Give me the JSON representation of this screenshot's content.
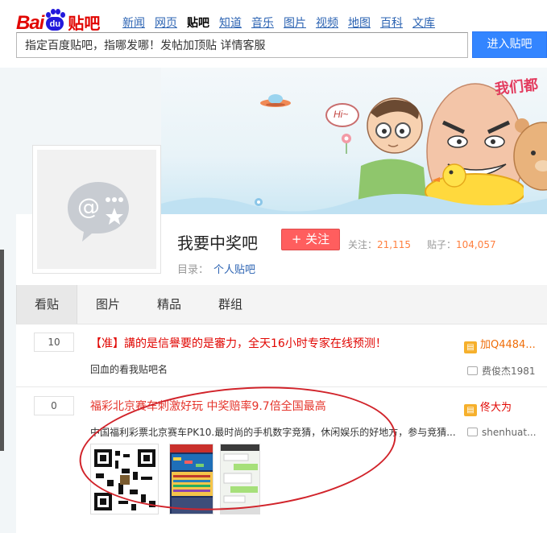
{
  "header": {
    "logo_bai": "Bai",
    "logo_du": "du",
    "logo_tieba": "贴吧",
    "nav": [
      "新闻",
      "网页",
      "贴吧",
      "知道",
      "音乐",
      "图片",
      "视频",
      "地图",
      "百科",
      "文库"
    ],
    "nav_active": "贴吧",
    "search_value": "指定百度贴吧，指哪发哪！发帖加顶贴 详情客服",
    "search_button": "进入贴吧"
  },
  "banner": {
    "bubble": "Hi~",
    "slogan": "我们都"
  },
  "forum": {
    "name": "我要中奖吧",
    "follow_label": "+ 关注",
    "follow_stat_label": "关注：",
    "follow_stat_value": "21,115",
    "post_stat_label": "贴子：",
    "post_stat_value": "104,057",
    "catalog_label": "目录：",
    "catalog_value": "个人贴吧"
  },
  "tabs": [
    "看贴",
    "图片",
    "精品",
    "群组"
  ],
  "tab_active": "看贴",
  "threads": [
    {
      "reply_count": "10",
      "title": "【准】講的是信譽要的是審力，全天16小时专家在线预测！",
      "snippet": "回血的看我贴吧名",
      "author": "加Q4484...",
      "last_reply": "费俊杰1981"
    },
    {
      "reply_count": "0",
      "title": "福彩北京赛车刺激好玩 中奖赔率9.7倍全国最高",
      "snippet": "中国福利彩票北京赛车PK10.最时尚的手机数字竞猜，休闲娱乐的好地方，参与竞猜...",
      "author": "佟大为",
      "last_reply": "shenhuat..."
    }
  ],
  "colors": {
    "accent_blue": "#3385ff",
    "brand_red": "#e10602",
    "follow_red": "#ff5e5e",
    "annotation_red": "#d1232a"
  }
}
